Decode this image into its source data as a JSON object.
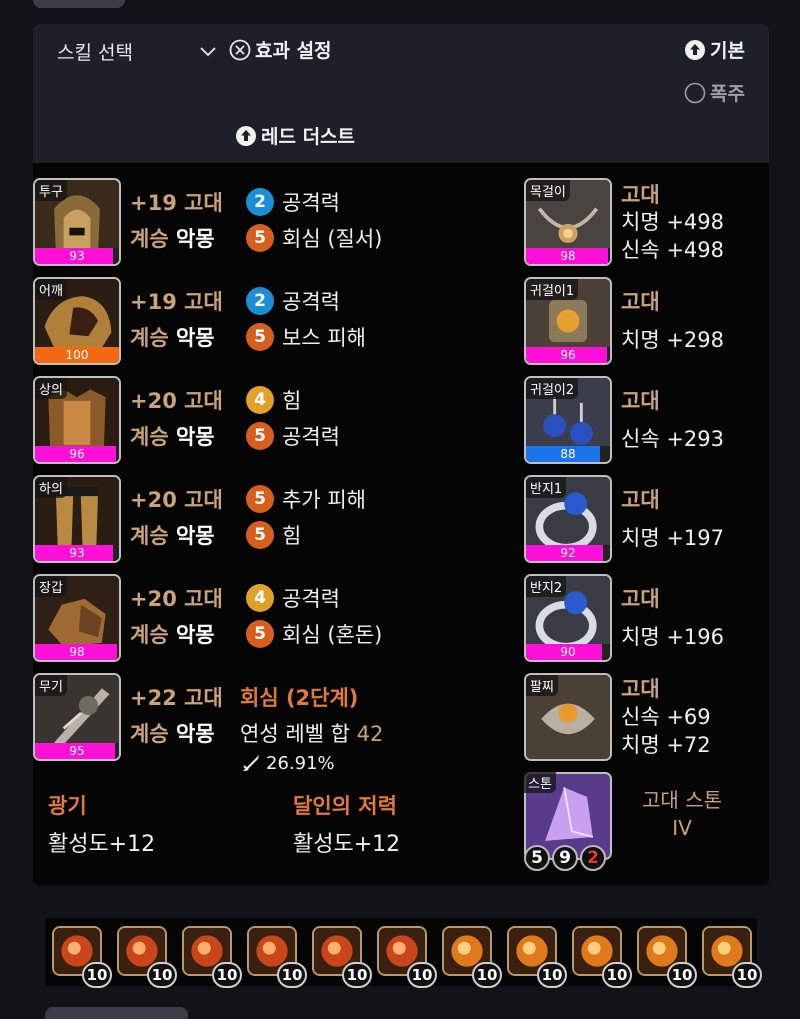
{
  "header": {
    "skill_select": "스킬 선택",
    "effect_setting": "효과 설정",
    "basic": "기본",
    "rampage": "폭주",
    "red_dust": "레드 더스트"
  },
  "armor": [
    {
      "slot": "투구",
      "quality": "93",
      "upgrade": "+19 고대",
      "tier_prefix": "계승",
      "tier": "악몽",
      "effects": [
        {
          "level": "2",
          "color": "#1b8ed6",
          "name": "공격력"
        },
        {
          "level": "5",
          "color": "#d65f1d",
          "name": "회심 (질서)"
        }
      ]
    },
    {
      "slot": "어깨",
      "quality": "100",
      "upgrade": "+19 고대",
      "tier_prefix": "계승",
      "tier": "악몽",
      "effects": [
        {
          "level": "2",
          "color": "#1b8ed6",
          "name": "공격력"
        },
        {
          "level": "5",
          "color": "#d65f1d",
          "name": "보스 피해"
        }
      ]
    },
    {
      "slot": "상의",
      "quality": "96",
      "upgrade": "+20 고대",
      "tier_prefix": "계승",
      "tier": "악몽",
      "effects": [
        {
          "level": "4",
          "color": "#e0a02a",
          "name": "힘"
        },
        {
          "level": "5",
          "color": "#d65f1d",
          "name": "공격력"
        }
      ]
    },
    {
      "slot": "하의",
      "quality": "93",
      "upgrade": "+20 고대",
      "tier_prefix": "계승",
      "tier": "악몽",
      "effects": [
        {
          "level": "5",
          "color": "#d65f1d",
          "name": "추가 피해"
        },
        {
          "level": "5",
          "color": "#d65f1d",
          "name": "힘"
        }
      ]
    },
    {
      "slot": "장갑",
      "quality": "98",
      "upgrade": "+20 고대",
      "tier_prefix": "계승",
      "tier": "악몽",
      "effects": [
        {
          "level": "4",
          "color": "#e0a02a",
          "name": "공격력"
        },
        {
          "level": "5",
          "color": "#d65f1d",
          "name": "회심 (혼돈)"
        }
      ]
    }
  ],
  "weapon": {
    "slot": "무기",
    "quality": "95",
    "upgrade": "+22 고대",
    "tier_prefix": "계승",
    "tier": "악몽",
    "effect": "회심 (2단계)",
    "sum_label": "연성 레벨 합",
    "sum_value": "42",
    "percent": "26.91%"
  },
  "accessories": [
    {
      "slot": "목걸이",
      "quality": "98",
      "grade": "고대",
      "stats": [
        "치명 +498",
        "신속 +498"
      ]
    },
    {
      "slot": "귀걸이1",
      "quality": "96",
      "grade": "고대",
      "stats": [
        "치명 +298"
      ]
    },
    {
      "slot": "귀걸이2",
      "quality": "88",
      "grade": "고대",
      "stats": [
        "신속 +293"
      ]
    },
    {
      "slot": "반지1",
      "quality": "92",
      "grade": "고대",
      "stats": [
        "치명 +197"
      ]
    },
    {
      "slot": "반지2",
      "quality": "90",
      "grade": "고대",
      "stats": [
        "치명 +196"
      ]
    },
    {
      "slot": "팔찌",
      "quality": "",
      "grade": "고대",
      "stats": [
        "신속 +69",
        "치명 +72"
      ]
    }
  ],
  "stone": {
    "slot": "스톤",
    "name_line1": "고대 스톤",
    "name_line2": "IV",
    "levels": [
      "5",
      "9",
      "2"
    ]
  },
  "engravings": [
    {
      "name": "광기",
      "value": "활성도+12"
    },
    {
      "name": "달인의 저력",
      "value": "활성도+12"
    }
  ],
  "gems": [
    {
      "level": "10",
      "type": "red"
    },
    {
      "level": "10",
      "type": "red"
    },
    {
      "level": "10",
      "type": "red"
    },
    {
      "level": "10",
      "type": "red"
    },
    {
      "level": "10",
      "type": "red"
    },
    {
      "level": "10",
      "type": "red"
    },
    {
      "level": "10",
      "type": "orange"
    },
    {
      "level": "10",
      "type": "orange"
    },
    {
      "level": "10",
      "type": "orange"
    },
    {
      "level": "10",
      "type": "orange"
    },
    {
      "level": "10",
      "type": "orange"
    }
  ],
  "colors": {
    "quality_magenta": "#ff10d8",
    "quality_orange": "#f26a10",
    "quality_blue": "#1a73e8",
    "gold_text": "#c9a27a",
    "orange_text": "#e07a3c"
  }
}
